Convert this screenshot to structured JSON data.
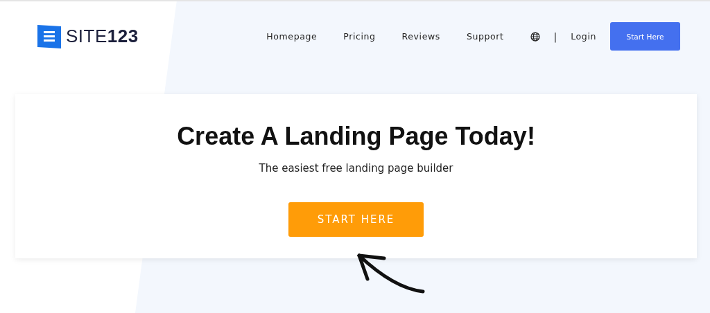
{
  "header": {
    "logo": "SITE**123**",
    "nav": [
      {
        "label": "Homepage",
        "kind": "link"
      },
      {
        "label": "Pricing",
        "kind": "link"
      },
      {
        "label": "Reviews",
        "kind": "link"
      },
      {
        "label": "Support",
        "kind": "link"
      },
      {
        "kind": "globe"
      },
      {
        "label": "|",
        "kind": "divider"
      },
      {
        "label": "Login",
        "kind": "link"
      },
      {
        "label": "Start Here",
        "kind": "button"
      }
    ]
  },
  "hero": {
    "title": "Create A Landing Page Today!",
    "subtitle": "The easiest free landing page builder",
    "button": "START HERE"
  }
}
